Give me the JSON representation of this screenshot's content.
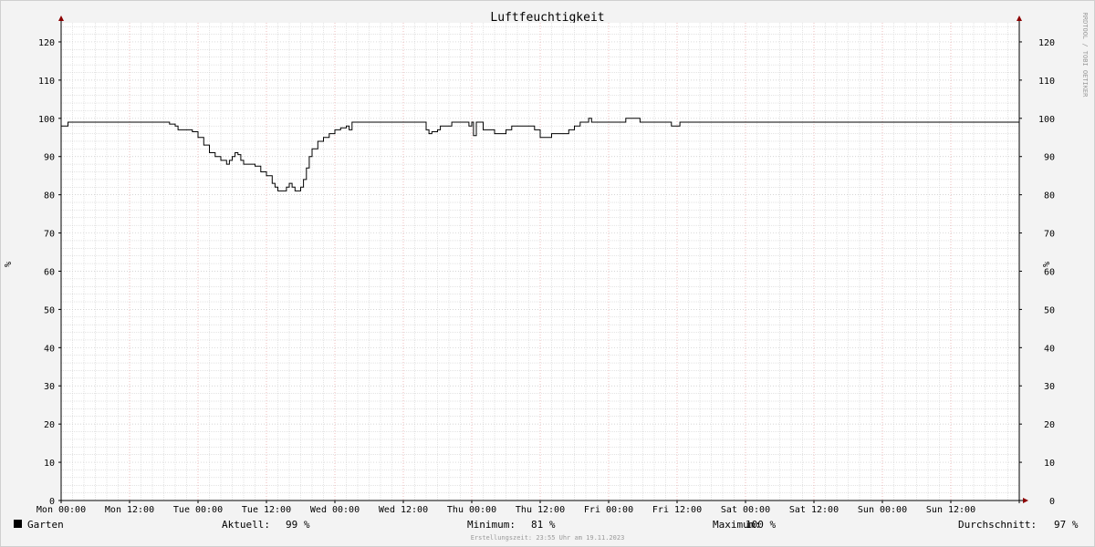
{
  "chart_data": {
    "type": "line",
    "title": "Luftfeuchtigkeit",
    "ylabel_left": "%",
    "ylabel_right": "%",
    "ylim": [
      0,
      125
    ],
    "yticks": [
      0,
      10,
      20,
      30,
      40,
      50,
      60,
      70,
      80,
      90,
      100,
      110,
      120
    ],
    "xticks": [
      "Mon 00:00",
      "Mon 12:00",
      "Tue 00:00",
      "Tue 12:00",
      "Wed 00:00",
      "Wed 12:00",
      "Thu 00:00",
      "Thu 12:00",
      "Fri 00:00",
      "Fri 12:00",
      "Sat 00:00",
      "Sat 12:00",
      "Sun 00:00",
      "Sun 12:00"
    ],
    "x_unit": "hours since Mon 00:00",
    "xlim": [
      0,
      168
    ],
    "grid": true,
    "series": [
      {
        "name": "Garten",
        "color": "#000000",
        "points": [
          [
            0,
            98
          ],
          [
            1,
            98
          ],
          [
            1.2,
            99
          ],
          [
            4,
            99
          ],
          [
            10,
            99
          ],
          [
            18,
            99
          ],
          [
            19,
            98.5
          ],
          [
            20,
            98
          ],
          [
            20.5,
            97
          ],
          [
            22,
            97
          ],
          [
            23,
            96.5
          ],
          [
            24,
            95
          ],
          [
            25,
            93
          ],
          [
            26,
            91
          ],
          [
            27,
            90
          ],
          [
            28,
            89
          ],
          [
            29,
            88
          ],
          [
            29.5,
            89
          ],
          [
            30,
            90
          ],
          [
            30.5,
            91
          ],
          [
            31,
            90.5
          ],
          [
            31.5,
            89
          ],
          [
            32,
            88
          ],
          [
            33,
            88
          ],
          [
            34,
            87.5
          ],
          [
            35,
            86
          ],
          [
            36,
            85
          ],
          [
            37,
            83
          ],
          [
            37.5,
            82
          ],
          [
            38,
            81
          ],
          [
            39,
            81
          ],
          [
            39.5,
            82
          ],
          [
            40,
            83
          ],
          [
            40.5,
            82
          ],
          [
            41,
            81
          ],
          [
            41.5,
            81
          ],
          [
            42,
            82
          ],
          [
            42.5,
            84
          ],
          [
            43,
            87
          ],
          [
            43.5,
            90
          ],
          [
            44,
            92
          ],
          [
            45,
            94
          ],
          [
            46,
            95
          ],
          [
            47,
            96
          ],
          [
            48,
            97
          ],
          [
            49,
            97.5
          ],
          [
            50,
            98
          ],
          [
            50.5,
            97
          ],
          [
            51,
            99
          ],
          [
            55,
            99
          ],
          [
            60,
            99
          ],
          [
            63,
            99
          ],
          [
            64,
            97
          ],
          [
            64.5,
            96
          ],
          [
            65,
            96.5
          ],
          [
            66,
            97
          ],
          [
            66.5,
            98
          ],
          [
            67,
            98
          ],
          [
            68,
            98
          ],
          [
            68.5,
            99
          ],
          [
            71,
            99
          ],
          [
            71.5,
            98
          ],
          [
            72,
            99
          ],
          [
            72.3,
            95.5
          ],
          [
            72.8,
            99
          ],
          [
            73.5,
            99
          ],
          [
            74,
            97
          ],
          [
            75,
            97
          ],
          [
            76,
            96
          ],
          [
            77,
            96
          ],
          [
            78,
            97
          ],
          [
            79,
            98
          ],
          [
            82,
            98
          ],
          [
            83,
            97
          ],
          [
            84,
            95
          ],
          [
            85,
            95
          ],
          [
            86,
            96
          ],
          [
            88,
            96
          ],
          [
            89,
            97
          ],
          [
            90,
            98
          ],
          [
            91,
            99
          ],
          [
            92,
            99
          ],
          [
            92.5,
            100
          ],
          [
            93,
            99
          ],
          [
            97,
            99
          ],
          [
            98,
            99
          ],
          [
            99,
            100
          ],
          [
            101,
            100
          ],
          [
            101.5,
            99
          ],
          [
            103,
            99
          ],
          [
            106,
            99
          ],
          [
            107,
            98
          ],
          [
            108,
            98
          ],
          [
            108.5,
            99
          ],
          [
            110,
            99
          ],
          [
            120,
            99
          ],
          [
            135,
            99
          ],
          [
            150,
            99
          ],
          [
            168,
            99
          ]
        ]
      }
    ]
  },
  "legend": {
    "color": "#000000",
    "label": "Garten"
  },
  "stats": {
    "aktuell_label": "Aktuell:",
    "aktuell_value": "99 %",
    "minimum_label": "Minimum:",
    "minimum_value": "81 %",
    "maximum_label": "Maximum:",
    "maximum_value": "100 %",
    "durchschnitt_label": "Durchschnitt:",
    "durchschnitt_value": "97 %"
  },
  "credit": "Erstellungszeit: 23:55 Uhr am 19.11.2023",
  "side_credit": "RRDTOOL / TOBI OETIKER",
  "colors": {
    "minor_grid": "#c8c8c8",
    "major_grid_y": "#c8c8c8",
    "major_grid_x": "#e8a0a0",
    "axis": "#000000",
    "arrow": "#8b0000"
  }
}
